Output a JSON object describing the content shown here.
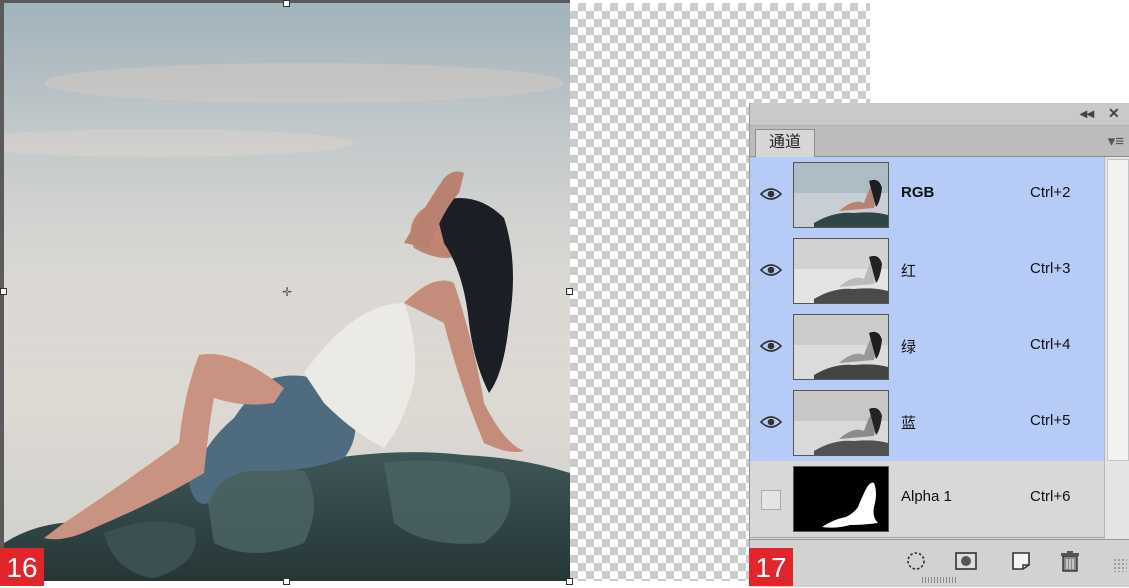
{
  "canvas": {
    "step_left": "16",
    "step_right": "17"
  },
  "channels_panel": {
    "collapse_glyph": "◂◂",
    "close_glyph": "✕",
    "tab_label": "通道",
    "menu_icon": "panel-menu-icon",
    "channels": [
      {
        "name": "RGB",
        "shortcut": "Ctrl+2",
        "visible": true,
        "selected": true
      },
      {
        "name": "红",
        "shortcut": "Ctrl+3",
        "visible": true,
        "selected": true
      },
      {
        "name": "绿",
        "shortcut": "Ctrl+4",
        "visible": true,
        "selected": true
      },
      {
        "name": "蓝",
        "shortcut": "Ctrl+5",
        "visible": true,
        "selected": true
      },
      {
        "name": "Alpha 1",
        "shortcut": "Ctrl+6",
        "visible": false,
        "selected": false
      }
    ],
    "bottom_icons": [
      "load-selection-icon",
      "save-selection-icon",
      "new-channel-icon",
      "trash-icon"
    ],
    "colors": {
      "selected_row": "#b6cbf6",
      "panel_bg": "#d6d6d6",
      "badge": "#e0262a"
    }
  }
}
